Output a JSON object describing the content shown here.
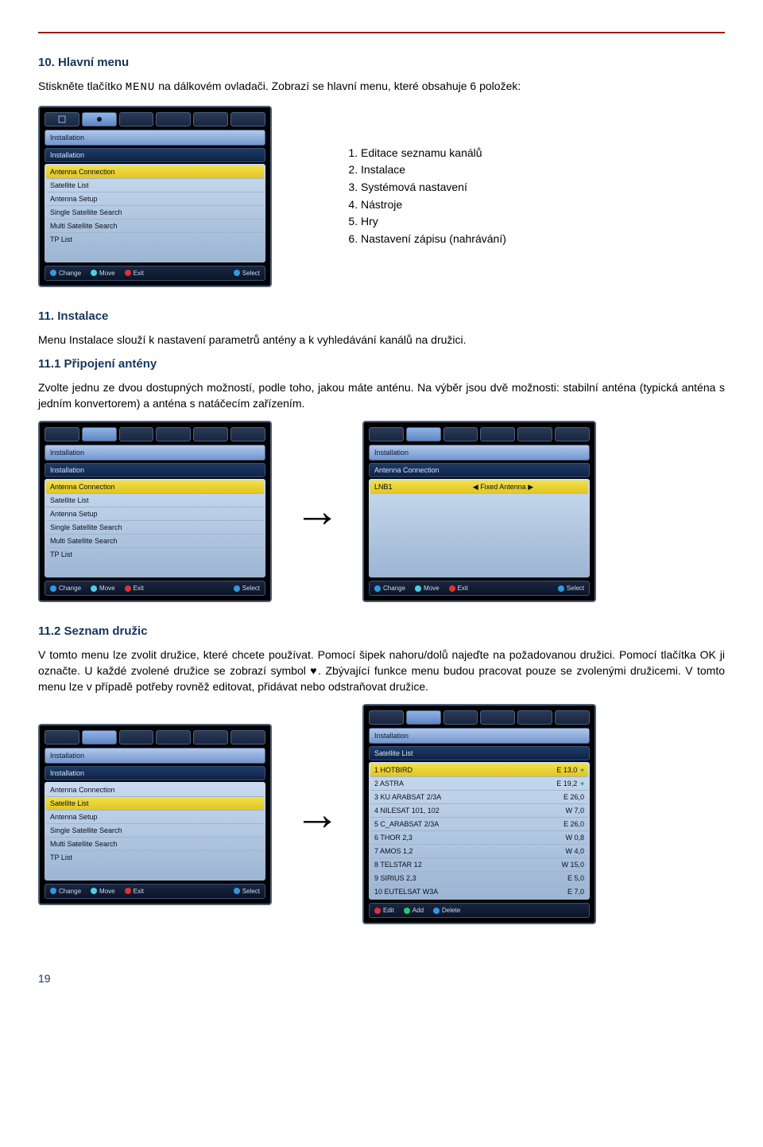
{
  "section10": {
    "title": "10. Hlavní menu",
    "intro_a": "Stiskněte tlačítko ",
    "key": "MENU",
    "intro_b": " na dálkovém ovladači.  Zobrazí se hlavní menu, které obsahuje 6 položek:",
    "items": [
      "Editace seznamu kanálů",
      "Instalace",
      "Systémová nastavení",
      "Nástroje",
      "Hry",
      "Nastavení zápisu (nahrávání)"
    ]
  },
  "section11": {
    "title": "11. Instalace",
    "text": "Menu Instalace slouží k nastavení parametrů antény a k vyhledávání kanálů na družici."
  },
  "section11_1": {
    "title": "11.1 Připojení antény",
    "text": "Zvolte jednu ze dvou dostupných možností, podle toho, jakou máte anténu. Na výběr jsou dvě možnosti: stabilní anténa (typická anténa s jedním konvertorem) a anténa s natáčecím zařízením."
  },
  "section11_2": {
    "title": "11.2 Seznam družic",
    "text": "V tomto menu lze zvolit družice, které chcete používat. Pomocí šipek nahoru/dolů najeďte na požadovanou družici. Pomocí tlačítka OK ji označte. U každé zvolené družice se zobrazí symbol ♥. Zbývající funkce menu budou pracovat pouze se zvolenými družicemi. V tomto menu lze v případě potřeby rovněž editovat, přidávat nebo odstraňovat družice."
  },
  "tv": {
    "header": "Installation",
    "subheader": "Installation",
    "items": [
      "Antenna Connection",
      "Satellite List",
      "Antenna Setup",
      "Single Satellite Search",
      "Multi Satellite Search",
      "TP List"
    ],
    "lnb_label": "LNB1",
    "lnb_value": "Fixed Antenna",
    "sat_list": [
      {
        "n": "1",
        "name": "HOTBIRD",
        "pos": "E 13,0",
        "mark": true
      },
      {
        "n": "2",
        "name": "ASTRA",
        "pos": "E 19,2",
        "mark": true
      },
      {
        "n": "3",
        "name": "KU ARABSAT 2/3A",
        "pos": "E 26,0"
      },
      {
        "n": "4",
        "name": "NILESAT 101, 102",
        "pos": "W 7,0"
      },
      {
        "n": "5",
        "name": "C_ARABSAT 2/3A",
        "pos": "E 26,0"
      },
      {
        "n": "6",
        "name": "THOR 2,3",
        "pos": "W 0,8"
      },
      {
        "n": "7",
        "name": "AMOS 1,2",
        "pos": "W 4,0"
      },
      {
        "n": "8",
        "name": "TELSTAR 12",
        "pos": "W 15,0"
      },
      {
        "n": "9",
        "name": "SIRIUS 2,3",
        "pos": "E 5,0"
      },
      {
        "n": "10",
        "name": "EUTELSAT W3A",
        "pos": "E 7,0"
      }
    ],
    "footer": {
      "change": "Change",
      "move": "Move",
      "exit": "Exit",
      "select": "Select",
      "edit": "Edit",
      "add": "Add",
      "delete": "Delete"
    }
  },
  "page_number": "19"
}
